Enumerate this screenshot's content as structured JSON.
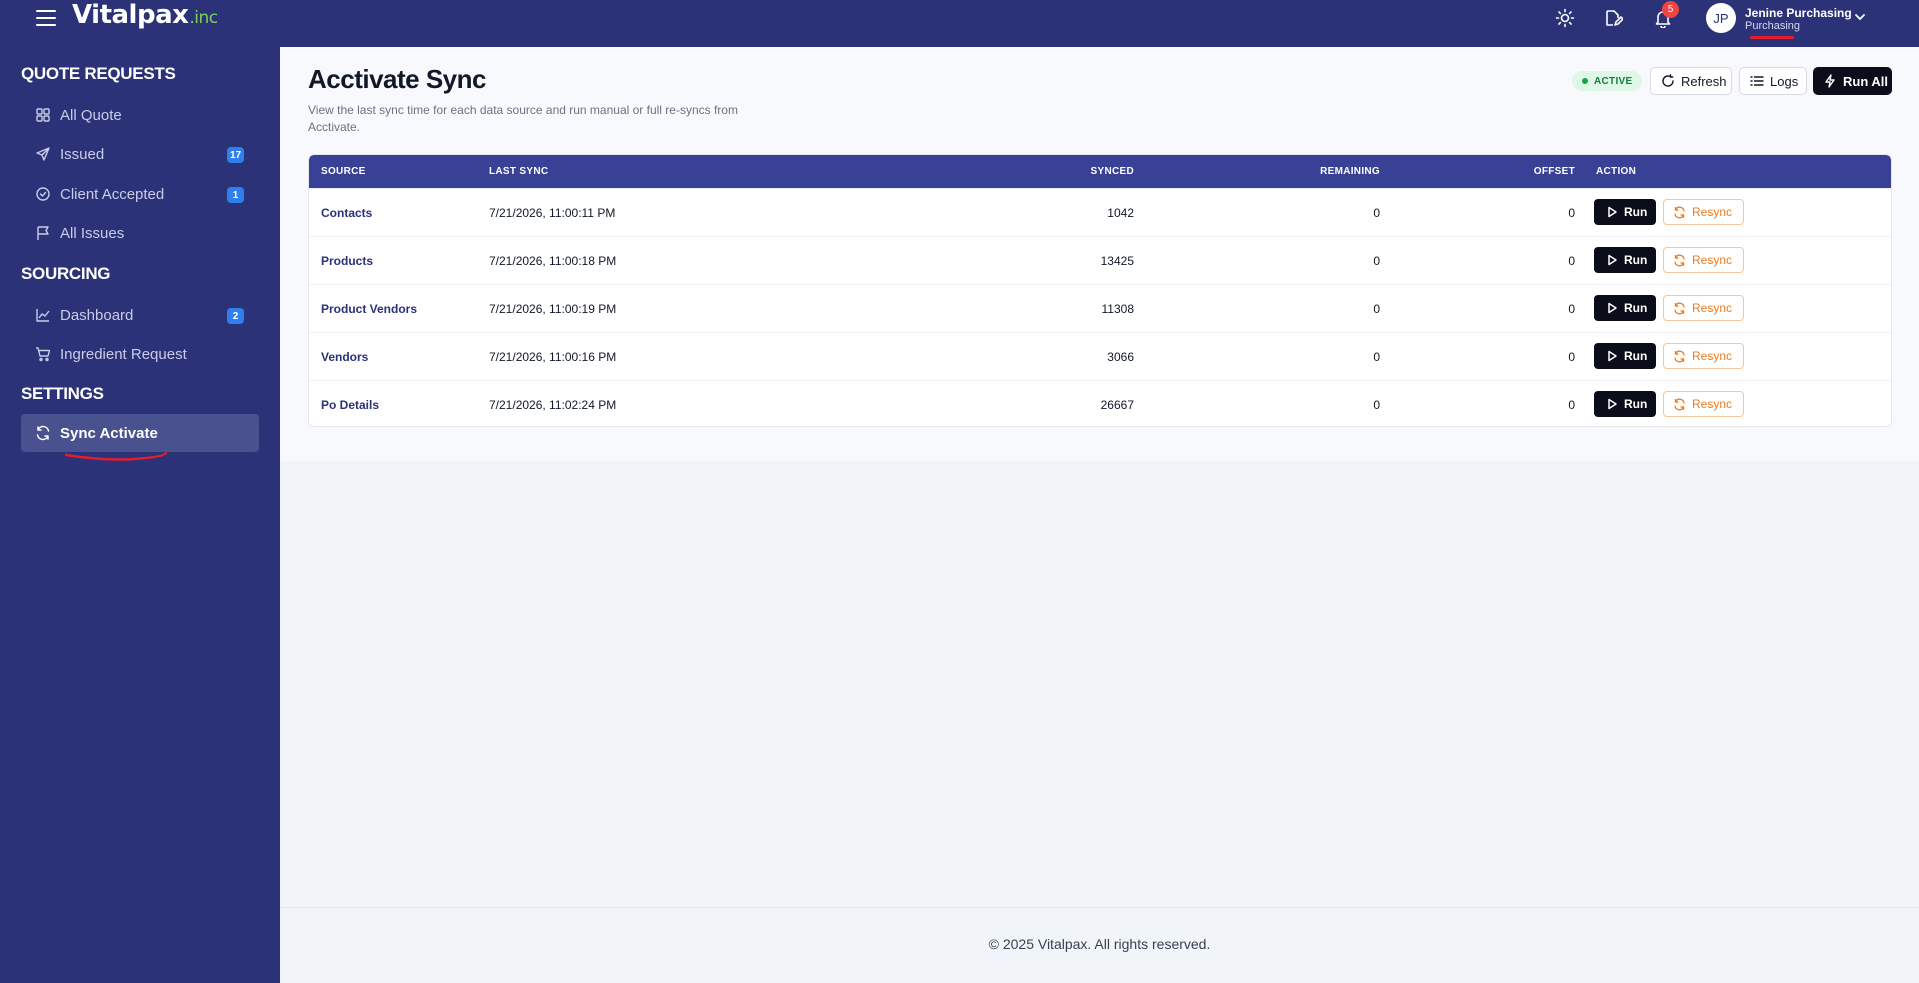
{
  "topbar": {
    "logo_main": "Vitalpax",
    "logo_suffix": ".inc",
    "notification_count": "5",
    "user": {
      "initials": "JP",
      "name": "Jenine Purchasing",
      "role": "Purchasing"
    }
  },
  "sidebar": {
    "sections": [
      {
        "title": "QUOTE REQUESTS"
      },
      {
        "title": "SOURCING"
      },
      {
        "title": "SETTINGS"
      }
    ],
    "items": [
      {
        "label": "All Quote",
        "icon": "grid-icon"
      },
      {
        "label": "Issued",
        "icon": "send-icon",
        "badge": "17"
      },
      {
        "label": "Client Accepted",
        "icon": "check-circle-icon",
        "badge": "1"
      },
      {
        "label": "All Issues",
        "icon": "flag-icon"
      },
      {
        "label": "Dashboard",
        "icon": "chart-line-icon",
        "badge": "2"
      },
      {
        "label": "Ingredient Request",
        "icon": "cart-icon"
      },
      {
        "label": "Sync Activate",
        "icon": "sync-icon",
        "active": true
      }
    ]
  },
  "page": {
    "title": "Acctivate Sync",
    "description": "View the last sync time for each data source and run manual or full re-syncs from Acctivate.",
    "status": "ACTIVE",
    "refresh_label": "Refresh",
    "logs_label": "Logs",
    "run_all_label": "Run All"
  },
  "table": {
    "headers": {
      "source": "SOURCE",
      "last_sync": "LAST SYNC",
      "synced": "SYNCED",
      "remaining": "REMAINING",
      "offset": "OFFSET",
      "action": "ACTION"
    },
    "run_label": "Run",
    "resync_label": "Resync",
    "rows": [
      {
        "source": "Contacts",
        "last_sync": "7/21/2026, 11:00:11 PM",
        "synced": "1042",
        "remaining": "0",
        "offset": "0"
      },
      {
        "source": "Products",
        "last_sync": "7/21/2026, 11:00:18 PM",
        "synced": "13425",
        "remaining": "0",
        "offset": "0"
      },
      {
        "source": "Product Vendors",
        "last_sync": "7/21/2026, 11:00:19 PM",
        "synced": "11308",
        "remaining": "0",
        "offset": "0"
      },
      {
        "source": "Vendors",
        "last_sync": "7/21/2026, 11:00:16 PM",
        "synced": "3066",
        "remaining": "0",
        "offset": "0"
      },
      {
        "source": "Po Details",
        "last_sync": "7/21/2026, 11:02:24 PM",
        "synced": "26667",
        "remaining": "0",
        "offset": "0"
      }
    ]
  },
  "footer": {
    "copyright": "© 2025 Vitalpax. All rights reserved."
  },
  "colors": {
    "brand_navy": "#2b3278",
    "table_header": "#394196",
    "accent_green": "#7dd35a",
    "resync_orange": "#ea7c1f",
    "badge_blue": "#2f80ed"
  }
}
